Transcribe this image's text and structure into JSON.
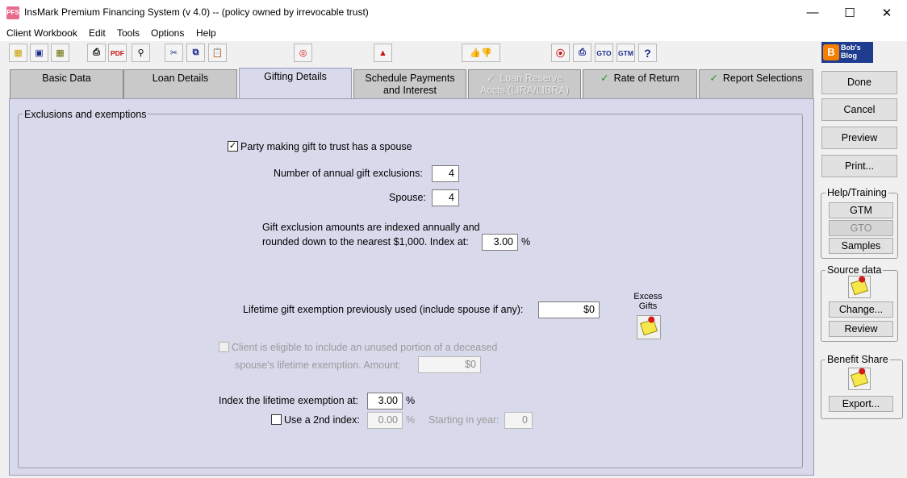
{
  "window": {
    "app_icon": "PFS",
    "title": "InsMark Premium Financing System (v 4.0) --  (policy owned by irrevocable trust)",
    "minimize": "—",
    "maximize": "☐",
    "close": "✕"
  },
  "menu": [
    "Client Workbook",
    "Edit",
    "Tools",
    "Options",
    "Help"
  ],
  "toolbar": {
    "icons": [
      "open-folder-icon",
      "save-icon",
      "export-folder-icon",
      "print-icon",
      "pdf-icon",
      "print-preview-icon",
      "cut-icon",
      "copy-icon",
      "paste-icon",
      "target-icon",
      "alert-icon",
      "thumbs-icon",
      "broadcast-icon",
      "fax-icon",
      "gto-icon",
      "gtm-icon",
      "help-icon"
    ],
    "pdf_label": "PDF",
    "gto_label": "GTO",
    "gtm_label": "GTM",
    "help_label": "?",
    "blog_label": "Bob's Blog"
  },
  "tabs": [
    {
      "label": "Basic Data"
    },
    {
      "label": "Loan Details"
    },
    {
      "label": "Gifting Details"
    },
    {
      "label": "Schedule Payments and Interest"
    },
    {
      "label": "Loan Reserve Accts (LIRA/LIBRA)"
    },
    {
      "label": "Rate of Return"
    },
    {
      "label": "Report Selections"
    }
  ],
  "group": {
    "title": "Exclusions and exemptions",
    "spouse_checkbox_label": "Party making gift to trust has a spouse",
    "annual_exclusions_label": "Number of annual gift exclusions:",
    "annual_exclusions_value": "4",
    "spouse_label": "Spouse:",
    "spouse_value": "4",
    "indexed_line1": "Gift exclusion amounts are indexed annually and",
    "indexed_line2": "rounded down to the nearest $1,000.  Index at:",
    "index_value": "3.00",
    "percent": "%",
    "lifetime_used_label": "Lifetime gift exemption previously used (include spouse if any):",
    "lifetime_used_value": "$0",
    "excess_gifts_label": "Excess Gifts",
    "deceased_line1": "Client is eligible to include an unused portion of a deceased",
    "deceased_line2": "spouse's lifetime exemption.  Amount:",
    "deceased_amount": "$0",
    "lifetime_index_label": "Index the lifetime exemption at:",
    "lifetime_index_value": "3.00",
    "second_index_label": "Use a 2nd index:",
    "second_index_value": "0.00",
    "starting_year_label": "Starting in year:",
    "starting_year_value": "0"
  },
  "right": {
    "done": "Done",
    "cancel": "Cancel",
    "preview": "Preview",
    "print": "Print...",
    "help_title": "Help/Training",
    "gtm": "GTM",
    "gto": "GTO",
    "samples": "Samples",
    "source_title": "Source data",
    "change": "Change...",
    "review": "Review",
    "benefit_title": "Benefit Share",
    "export": "Export..."
  },
  "colors": {
    "pane": "#d9d9ec",
    "tab_inactive": "#c9c9c9",
    "check_green": "#1a9e1a"
  }
}
